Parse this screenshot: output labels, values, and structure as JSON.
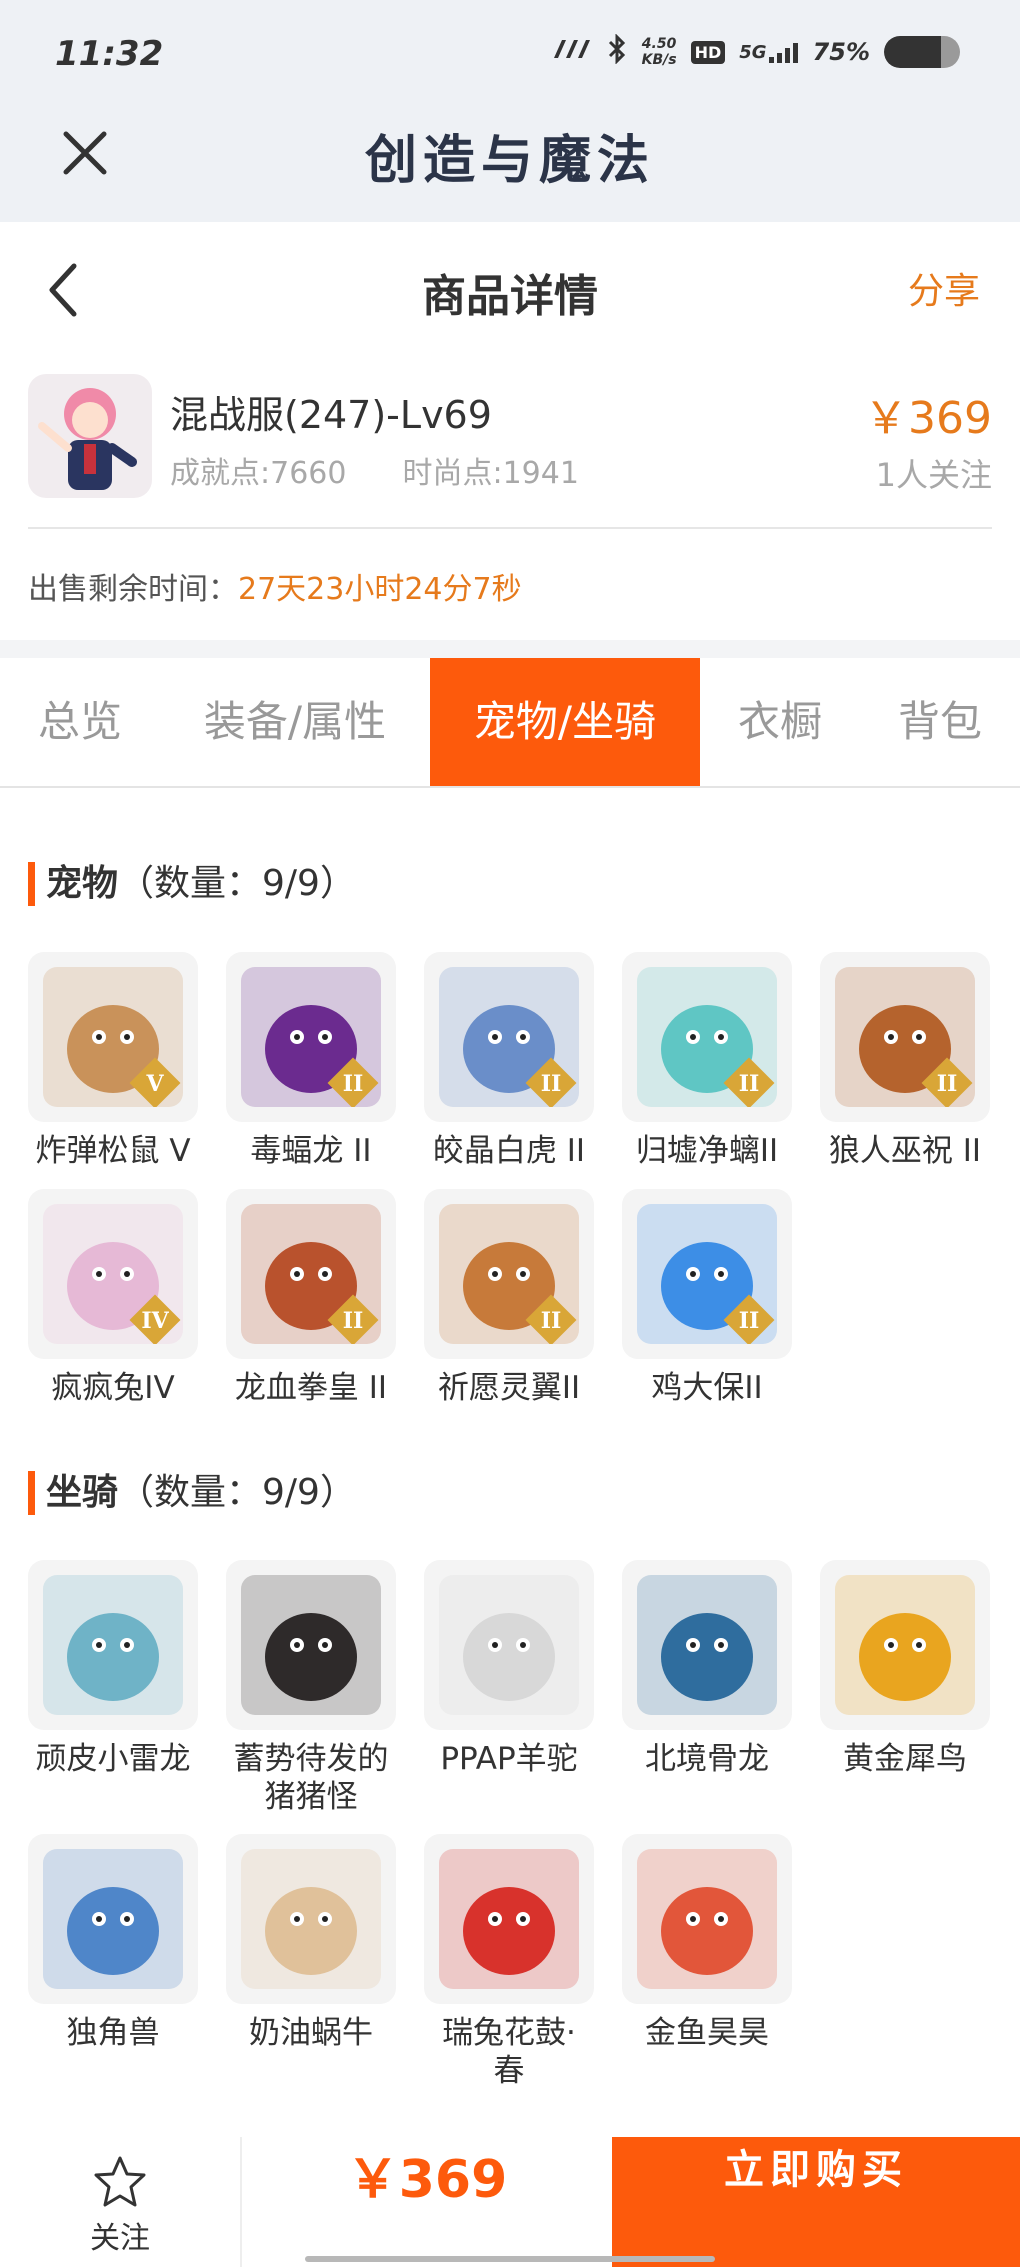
{
  "status_bar": {
    "time": "11:32",
    "net_speed_value": "4.50",
    "net_speed_unit": "KB/s",
    "hd": "HD",
    "network": "5G",
    "battery": "75%",
    "battery_level": 0.75
  },
  "app_bar": {
    "title": "创造与魔法",
    "close_icon": "close-icon"
  },
  "nav": {
    "title": "商品详情",
    "share": "分享",
    "back_icon": "chevron-left-icon"
  },
  "product": {
    "name": "混战服(247)-Lv69",
    "achievement": "成就点:7660",
    "fashion": "时尚点:1941",
    "price": "￥369",
    "followers": "1人关注",
    "sale_time_label": "出售剩余时间：",
    "sale_time_value": "27天23小时24分7秒"
  },
  "tabs": [
    {
      "label": "总览",
      "active": false
    },
    {
      "label": "装备/属性",
      "active": false
    },
    {
      "label": "宠物/坐骑",
      "active": true
    },
    {
      "label": "衣橱",
      "active": false
    },
    {
      "label": "背包",
      "active": false
    }
  ],
  "pets": {
    "title": "宠物",
    "count": "（数量：9/9）",
    "items": [
      {
        "name": "炸弹松鼠 V",
        "rank": "V",
        "color": "#c9925a"
      },
      {
        "name": "毒蝠龙 II",
        "rank": "II",
        "color": "#6b2b8f"
      },
      {
        "name": "皎晶白虎 II",
        "rank": "II",
        "color": "#6a8ec9"
      },
      {
        "name": "归墟净螭II",
        "rank": "II",
        "color": "#5fc6c4"
      },
      {
        "name": "狼人巫祝 II",
        "rank": "II",
        "color": "#b5632d"
      },
      {
        "name": "疯疯兔IV",
        "rank": "IV",
        "color": "#e6b9d6"
      },
      {
        "name": "龙血拳皇 II",
        "rank": "II",
        "color": "#b9522d"
      },
      {
        "name": "祈愿灵翼II",
        "rank": "II",
        "color": "#c77a3a"
      },
      {
        "name": "鸡大保II",
        "rank": "II",
        "color": "#3d8ee6"
      }
    ]
  },
  "mounts": {
    "title": "坐骑",
    "count": "（数量：9/9）",
    "items": [
      {
        "name": "顽皮小雷龙",
        "name2": "",
        "color": "#6fb3c7"
      },
      {
        "name": "蓄势待发的",
        "name2": "猪猪怪",
        "color": "#2e2a2a"
      },
      {
        "name": "PPAP羊驼",
        "name2": "",
        "color": "#d8d8d8"
      },
      {
        "name": "北境骨龙",
        "name2": "",
        "color": "#2f6d9e"
      },
      {
        "name": "黄金犀鸟",
        "name2": "",
        "color": "#e9a51f"
      },
      {
        "name": "独角兽",
        "name2": "",
        "color": "#4f86c9"
      },
      {
        "name": "奶油蜗牛",
        "name2": "",
        "color": "#e0c19a"
      },
      {
        "name": "瑞兔花鼓·",
        "name2": "春",
        "color": "#d8322c"
      },
      {
        "name": "金鱼昊昊",
        "name2": "",
        "color": "#e2563a"
      }
    ]
  },
  "bottom_bar": {
    "follow": "关注",
    "price": "￥369",
    "buy": "立即购买"
  },
  "colors": {
    "accent": "#fd5a0c",
    "price": "#e67a1c"
  }
}
